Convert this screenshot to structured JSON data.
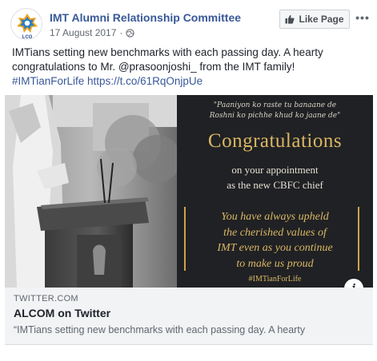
{
  "post": {
    "page_name": "IMT Alumni Relationship Committee",
    "date": "17 August 2017",
    "separator": "·",
    "like_page_label": "Like Page",
    "more_label": "•••",
    "text_line1": "IMTians setting new benchmarks with each passing day. A hearty",
    "text_line2": "congratulations to Mr. @prasoonjoshi_ from the IMT family!",
    "hashtag": "#IMTianForLife",
    "url": "https://t.co/61RqOnjpUe"
  },
  "image": {
    "quote_line1": "\"Paaniyon ko raste tu banaane de",
    "quote_line2": "Roshni ko pichhe khud ko jaane de\"",
    "heading": "Congratulations",
    "appointment_line1": "on your appointment",
    "appointment_line2": "as the new CBFC chief",
    "tagline_line1": "You have always upheld",
    "tagline_line2": "the cherished values of",
    "tagline_line3": "IMT even as you continue",
    "tagline_line4": "to make us proud",
    "hashtag": "#IMTianForLife",
    "info_label": "i"
  },
  "preview": {
    "domain": "TWITTER.COM",
    "title": "ALCOM on Twitter",
    "description": "“IMTians setting new benchmarks with each passing day. A hearty"
  },
  "avatar": {
    "label": "LCO"
  },
  "colors": {
    "link": "#385898",
    "gold": "#d9b765",
    "dark_bg": "#202124"
  }
}
